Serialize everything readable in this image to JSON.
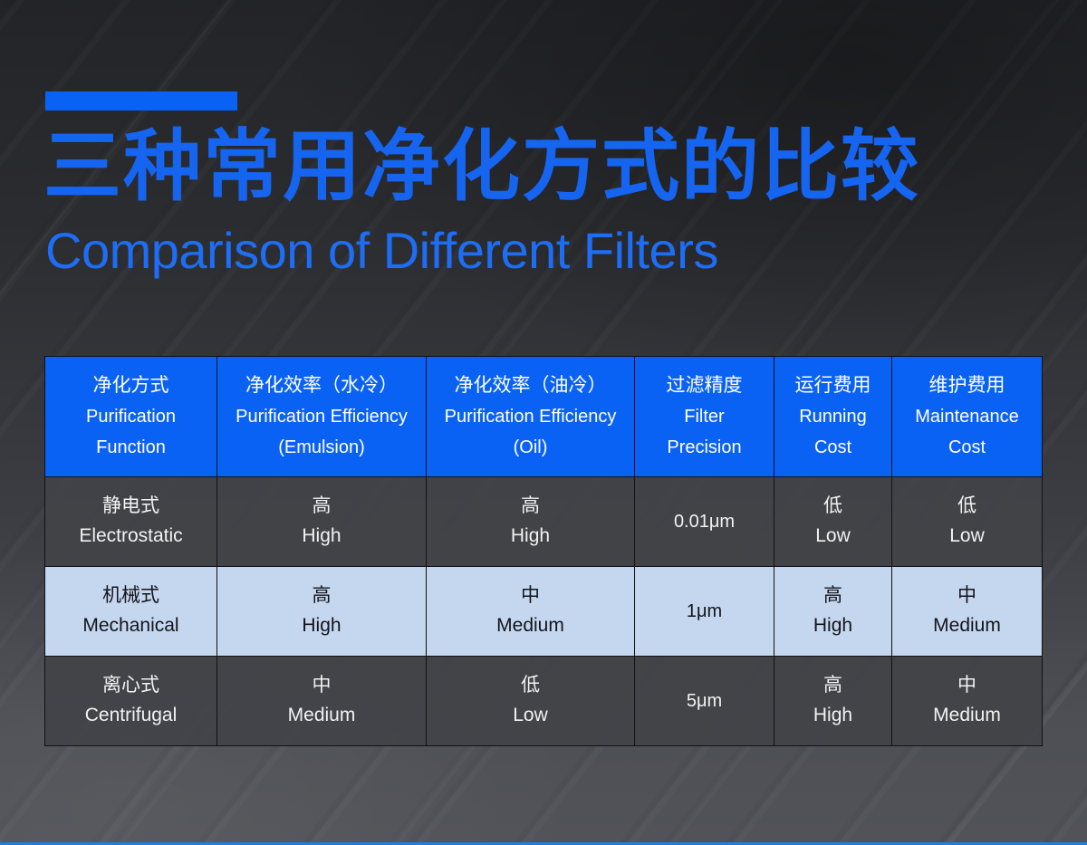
{
  "header": {
    "accent_bar_color": "#0a62f5",
    "title_zh": "三种常用净化方式的比较",
    "title_en": "Comparison of Different Filters",
    "title_color": "#1565f0"
  },
  "theme": {
    "accent": "#0a62f5",
    "header_text": "#ffffff",
    "dark_row_bg": "#424348",
    "light_row_bg": "#c5d6ef",
    "bottom_rule": "#1f7ede"
  },
  "table": {
    "columns": [
      {
        "zh": "净化方式",
        "en_line1": "Purification",
        "en_line2": "Function"
      },
      {
        "zh": "净化效率（水冷）",
        "en_line1": "Purification Efficiency",
        "en_line2": "(Emulsion)"
      },
      {
        "zh": "净化效率（油冷）",
        "en_line1": "Purification Efficiency",
        "en_line2": "(Oil)"
      },
      {
        "zh": "过滤精度",
        "en_line1": "Filter",
        "en_line2": "Precision"
      },
      {
        "zh": "运行费用",
        "en_line1": "Running",
        "en_line2": "Cost"
      },
      {
        "zh": "维护费用",
        "en_line1": "Maintenance",
        "en_line2": "Cost"
      }
    ],
    "rows": [
      {
        "style": "dark",
        "cells": [
          {
            "zh": "静电式",
            "en": "Electrostatic"
          },
          {
            "zh": "高",
            "en": "High"
          },
          {
            "zh": "高",
            "en": "High"
          },
          {
            "value": "0.01μm"
          },
          {
            "zh": "低",
            "en": "Low"
          },
          {
            "zh": "低",
            "en": "Low"
          }
        ]
      },
      {
        "style": "light",
        "cells": [
          {
            "zh": "机械式",
            "en": "Mechanical"
          },
          {
            "zh": "高",
            "en": "High"
          },
          {
            "zh": "中",
            "en": "Medium"
          },
          {
            "value": "1μm"
          },
          {
            "zh": "高",
            "en": "High"
          },
          {
            "zh": "中",
            "en": "Medium"
          }
        ]
      },
      {
        "style": "dark",
        "cells": [
          {
            "zh": "离心式",
            "en": "Centrifugal"
          },
          {
            "zh": "中",
            "en": "Medium"
          },
          {
            "zh": "低",
            "en": "Low"
          },
          {
            "value": "5μm"
          },
          {
            "zh": "高",
            "en": "High"
          },
          {
            "zh": "中",
            "en": "Medium"
          }
        ]
      }
    ]
  }
}
